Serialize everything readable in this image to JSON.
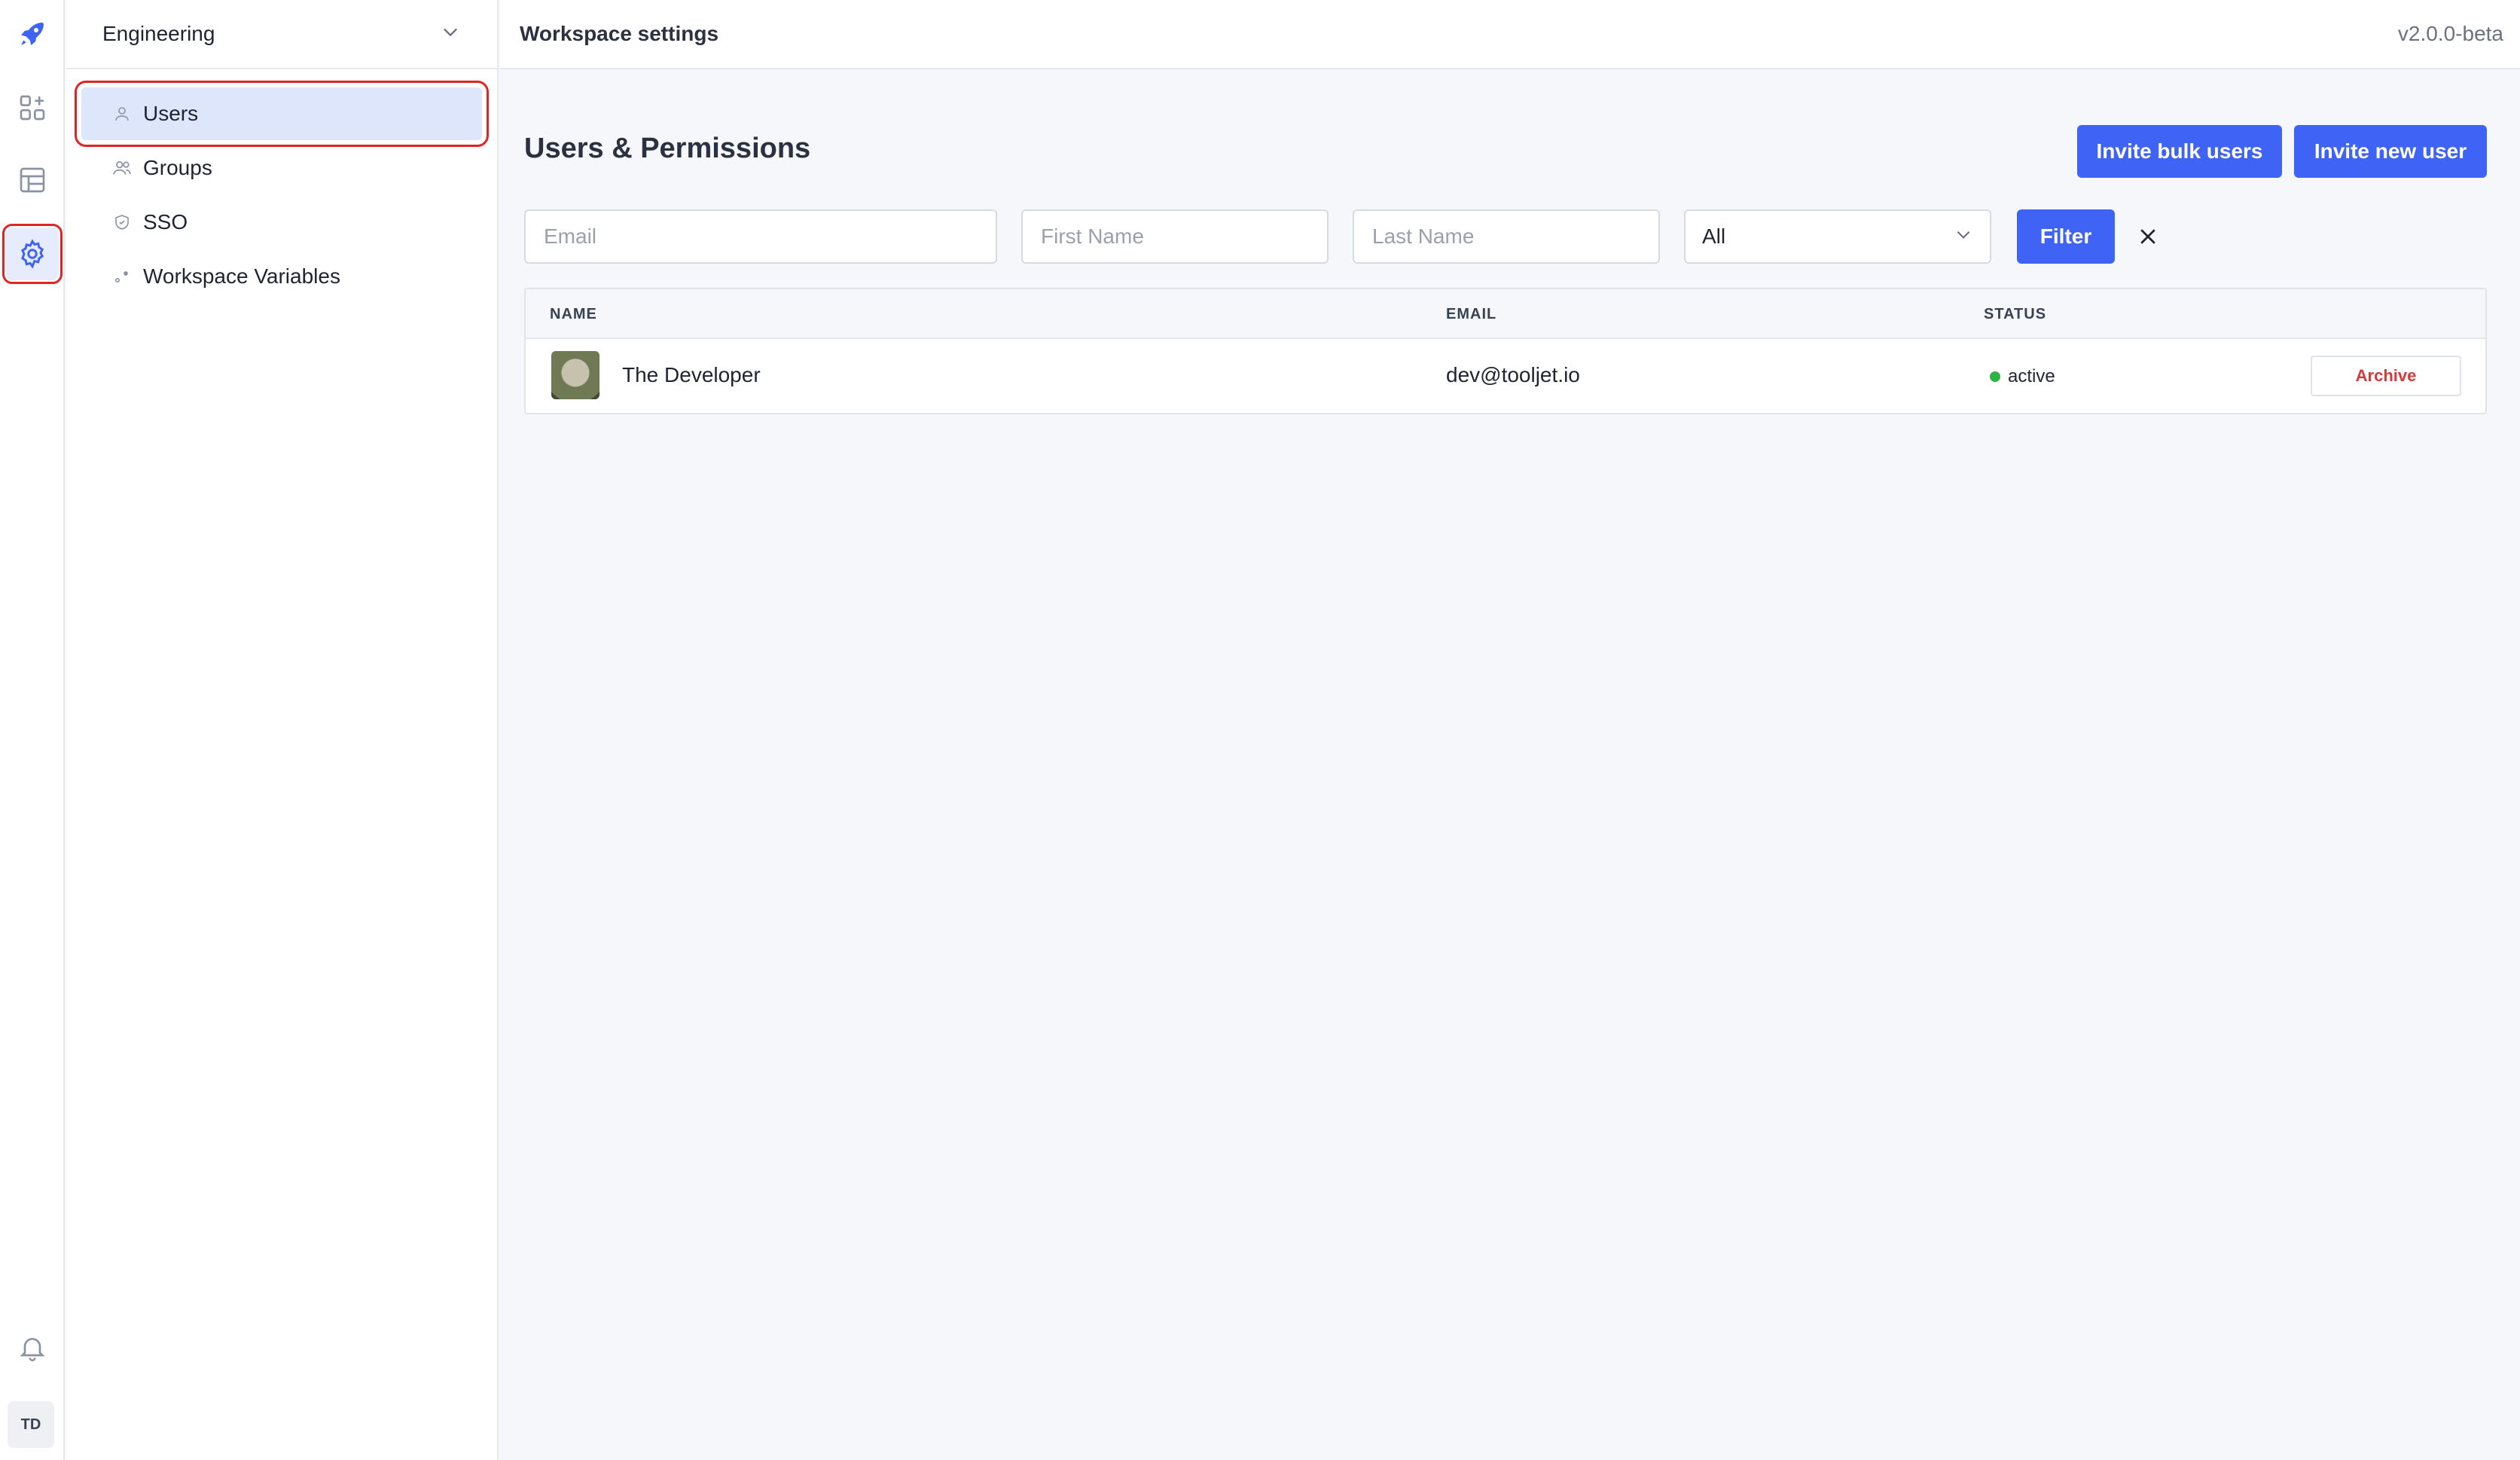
{
  "rail": {
    "items": [
      {
        "name": "logo-icon"
      },
      {
        "name": "apps-icon"
      },
      {
        "name": "database-icon"
      },
      {
        "name": "settings-gear-icon"
      },
      {
        "name": "bell-icon"
      }
    ],
    "user_initials": "TD"
  },
  "sidebar": {
    "workspace_name": "Engineering",
    "items": [
      {
        "label": "Users",
        "icon": "user-icon"
      },
      {
        "label": "Groups",
        "icon": "users-group-icon"
      },
      {
        "label": "SSO",
        "icon": "shield-icon"
      },
      {
        "label": "Workspace Variables",
        "icon": "variables-icon"
      }
    ]
  },
  "header": {
    "title": "Workspace settings",
    "version": "v2.0.0-beta"
  },
  "main": {
    "title": "Users & Permissions",
    "invite_bulk_label": "Invite bulk users",
    "invite_new_label": "Invite new user",
    "filters": {
      "email_placeholder": "Email",
      "first_name_placeholder": "First Name",
      "last_name_placeholder": "Last Name",
      "status_selected": "All",
      "filter_label": "Filter"
    },
    "table": {
      "headers": {
        "name": "NAME",
        "email": "EMAIL",
        "status": "STATUS"
      },
      "rows": [
        {
          "name": "The Developer",
          "email": "dev@tooljet.io",
          "status": "active",
          "action": "Archive"
        }
      ]
    }
  },
  "colors": {
    "primary": "#3e63f5",
    "active_status": "#2fb344",
    "archive_text": "#d63939",
    "highlight_border": "#e02424"
  }
}
